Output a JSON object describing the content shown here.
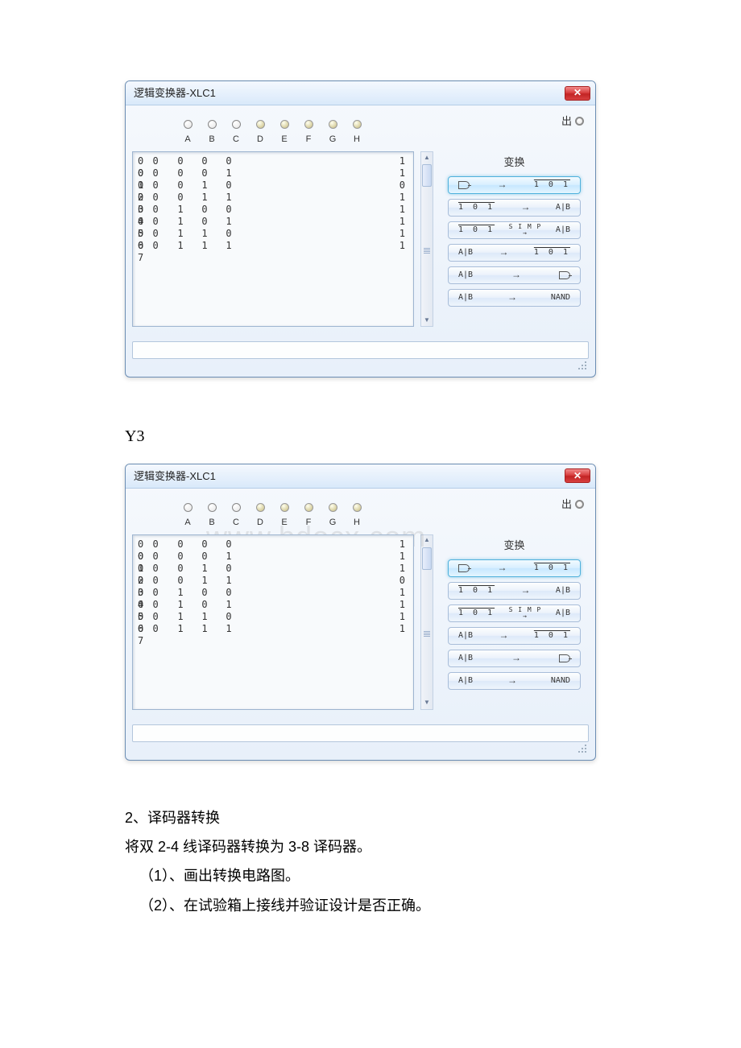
{
  "y3_label": "Y3",
  "window1": {
    "title": "逻辑变换器-XLC1",
    "out_label": "出",
    "convert_title": "变换",
    "inputs": [
      "A",
      "B",
      "C",
      "D",
      "E",
      "F",
      "G",
      "H"
    ],
    "filled_from_index": 3,
    "active_button_index": 0,
    "truth": {
      "indices": [
        "0 0 0",
        "0 0 1",
        "0 0 2",
        "0 0 3",
        "0 0 4",
        "0 0 5",
        "0 0 6",
        "0 0 7"
      ],
      "rows": [
        [
          "0",
          "0",
          "0"
        ],
        [
          "0",
          "0",
          "1"
        ],
        [
          "0",
          "1",
          "0"
        ],
        [
          "0",
          "1",
          "1"
        ],
        [
          "1",
          "0",
          "0"
        ],
        [
          "1",
          "0",
          "1"
        ],
        [
          "1",
          "1",
          "0"
        ],
        [
          "1",
          "1",
          "1"
        ]
      ],
      "out": [
        "1",
        "1",
        "0",
        "1",
        "1",
        "1",
        "1",
        "1"
      ]
    },
    "buttons": [
      {
        "left": "gate",
        "mid": "→",
        "right": "101bar"
      },
      {
        "left": "101bar",
        "mid": "→",
        "right": "AIB"
      },
      {
        "left": "101bar",
        "mid": "SIMP",
        "right": "AIB"
      },
      {
        "left": "AIB",
        "mid": "→",
        "right": "101bar"
      },
      {
        "left": "AIB",
        "mid": "→",
        "right": "gate"
      },
      {
        "left": "AIB",
        "mid": "→",
        "right": "NAND"
      }
    ]
  },
  "window2": {
    "title": "逻辑变换器-XLC1",
    "out_label": "出",
    "convert_title": "变换",
    "inputs": [
      "A",
      "B",
      "C",
      "D",
      "E",
      "F",
      "G",
      "H"
    ],
    "filled_from_index": 3,
    "active_button_index": 0,
    "watermark": "www.bdocx.com",
    "truth": {
      "indices": [
        "0 0 0",
        "0 0 1",
        "0 0 2",
        "0 0 3",
        "0 0 4",
        "0 0 5",
        "0 0 6",
        "0 0 7"
      ],
      "rows": [
        [
          "0",
          "0",
          "0"
        ],
        [
          "0",
          "0",
          "1"
        ],
        [
          "0",
          "1",
          "0"
        ],
        [
          "0",
          "1",
          "1"
        ],
        [
          "1",
          "0",
          "0"
        ],
        [
          "1",
          "0",
          "1"
        ],
        [
          "1",
          "1",
          "0"
        ],
        [
          "1",
          "1",
          "1"
        ]
      ],
      "out": [
        "1",
        "1",
        "1",
        "0",
        "1",
        "1",
        "1",
        "1"
      ]
    },
    "buttons": [
      {
        "left": "gate",
        "mid": "→",
        "right": "101bar"
      },
      {
        "left": "101bar",
        "mid": "→",
        "right": "AIB"
      },
      {
        "left": "101bar",
        "mid": "SIMP",
        "right": "AIB"
      },
      {
        "left": "AIB",
        "mid": "→",
        "right": "101bar"
      },
      {
        "left": "AIB",
        "mid": "→",
        "right": "gate"
      },
      {
        "left": "AIB",
        "mid": "→",
        "right": "NAND"
      }
    ]
  },
  "text": {
    "line1": "2、译码器转换",
    "line2": "将双 2-4 线译码器转换为 3-8 译码器。",
    "line3": "（1）、画出转换电路图。",
    "line4": "（2）、在试验箱上接线并验证设计是否正确。"
  }
}
